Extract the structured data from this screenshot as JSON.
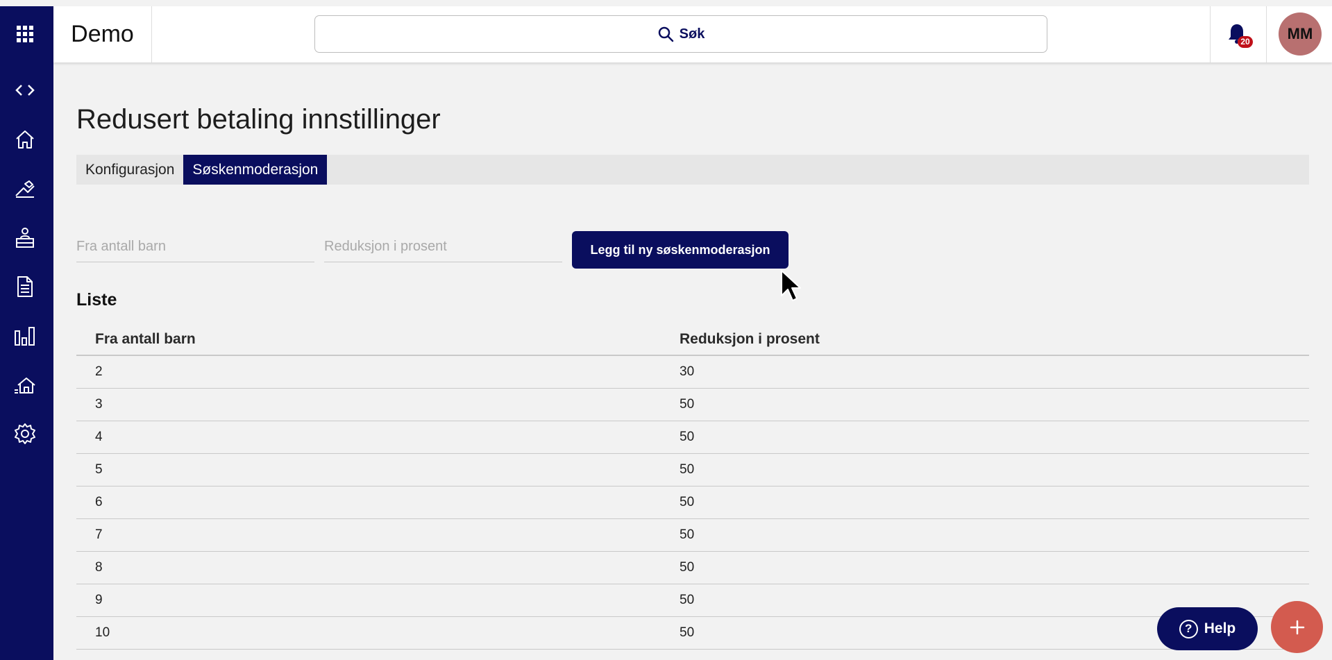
{
  "header": {
    "app_title": "Demo",
    "search_label": "Søk",
    "notification_count": "20",
    "avatar_initials": "MM"
  },
  "sidebar": {
    "items": [
      {
        "icon": "apps-grid-icon"
      },
      {
        "icon": "code-icon"
      },
      {
        "icon": "home-icon"
      },
      {
        "icon": "playground-icon"
      },
      {
        "icon": "kindergarten-icon"
      },
      {
        "icon": "document-icon"
      },
      {
        "icon": "bar-chart-icon"
      },
      {
        "icon": "building-icon"
      },
      {
        "icon": "gear-icon"
      }
    ]
  },
  "page": {
    "title": "Redusert betaling innstillinger",
    "tabs": [
      {
        "label": "Konfigurasjon",
        "active": false
      },
      {
        "label": "Søskenmoderasjon",
        "active": true
      }
    ]
  },
  "form": {
    "children_placeholder": "Fra antall barn",
    "reduction_placeholder": "Reduksjon i prosent",
    "add_button": "Legg til ny søskenmoderasjon"
  },
  "list": {
    "title": "Liste",
    "columns": [
      "Fra antall barn",
      "Reduksjon i prosent"
    ],
    "rows": [
      [
        "2",
        "30"
      ],
      [
        "3",
        "50"
      ],
      [
        "4",
        "50"
      ],
      [
        "5",
        "50"
      ],
      [
        "6",
        "50"
      ],
      [
        "7",
        "50"
      ],
      [
        "8",
        "50"
      ],
      [
        "9",
        "50"
      ],
      [
        "10",
        "50"
      ]
    ]
  },
  "help_button": "Help",
  "colors": {
    "navy": "#0a0e5e",
    "fab": "#d35b4f",
    "avatar": "#b87070",
    "badge": "#c0111a",
    "background": "#f2f2f2"
  }
}
